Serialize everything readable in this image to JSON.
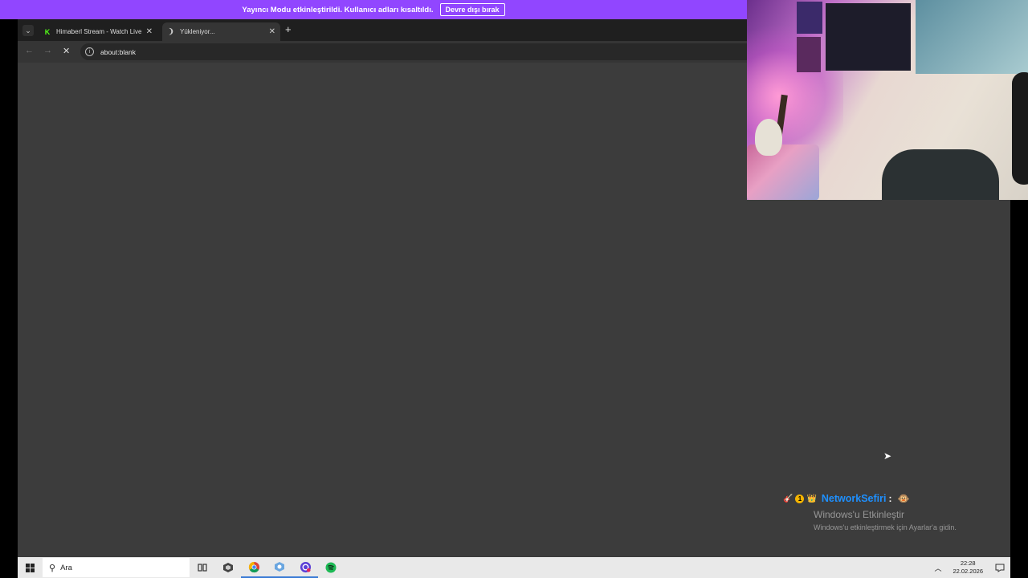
{
  "banner": {
    "message": "Yayıncı Modu etkinleştirildi. Kullanıcı adları kısaltıldı.",
    "disable_label": "Devre dışı bırak"
  },
  "browser": {
    "tabs": [
      {
        "title": "Himaberl Stream - Watch Live o",
        "favicon": "kick-icon"
      },
      {
        "title": "Yükleniyor...",
        "favicon": "loading-icon"
      }
    ],
    "address": "about:blank"
  },
  "chat": {
    "username": "NetworkSefiri",
    "separator": ":"
  },
  "watermark": {
    "title": "Windows'u Etkinleştir",
    "subtitle": "Windows'u etkinleştirmek için Ayarlar'a gidin."
  },
  "taskbar": {
    "search_placeholder": "Ara",
    "time": "22:28",
    "date": "22.02.2026"
  },
  "colors": {
    "banner": "#9146ff",
    "kick_green": "#53fc18",
    "chat_username": "#1e90ff"
  }
}
